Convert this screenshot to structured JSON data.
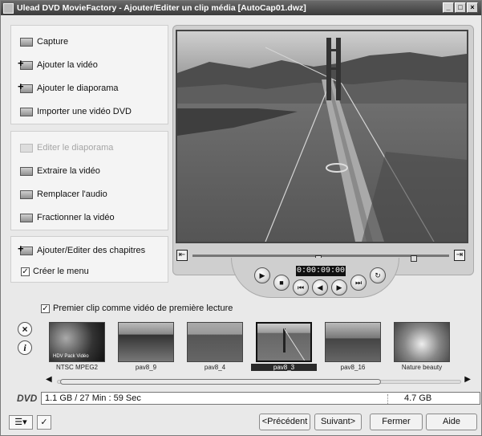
{
  "window": {
    "title": "Ulead DVD MovieFactory - Ajouter/Editer un clip média   [AutoCap01.dwz]",
    "btn_min": "_",
    "btn_max": "□",
    "btn_close": "×"
  },
  "left_panel": {
    "group1": [
      {
        "label": "Capture"
      },
      {
        "label": "Ajouter la vidéo"
      },
      {
        "label": "Ajouter le diaporama"
      },
      {
        "label": "Importer une vidéo DVD"
      }
    ],
    "group2": [
      {
        "label": "Editer le diaporama",
        "disabled": true
      },
      {
        "label": "Extraire la vidéo"
      },
      {
        "label": "Remplacer l'audio"
      },
      {
        "label": "Fractionner la vidéo"
      }
    ],
    "chapters_label": "Ajouter/Editer des chapitres",
    "create_menu_label": "Créer le menu",
    "create_menu_checked": true
  },
  "player": {
    "timecode": "0:00:09:00",
    "progress": 0.48
  },
  "clips": {
    "first_clip_label": "Premier clip comme vidéo de première lecture",
    "first_clip_checked": true,
    "items": [
      {
        "caption": "NTSC MPEG2",
        "overlay": "HDV Pack Vidéo",
        "selected": false
      },
      {
        "caption": "pav8_9",
        "selected": false
      },
      {
        "caption": "pav8_4",
        "selected": false
      },
      {
        "caption": "pav8_3",
        "selected": true
      },
      {
        "caption": "pav8_16",
        "selected": false
      },
      {
        "caption": "Nature beauty",
        "selected": false
      }
    ]
  },
  "dvd": {
    "label": "DVD",
    "usage": "1.1 GB / 27 Min : 59 Sec",
    "capacity": "4.7 GB",
    "fill": 0.23
  },
  "footer": {
    "prev": "<Précédent",
    "next": "Suivant>",
    "close": "Fermer",
    "help": "Aide"
  },
  "colors": {
    "title_bar": "#3a3a3a",
    "panel_bg": "#f4f4f4",
    "selected_clip": "#2a2a2a"
  }
}
